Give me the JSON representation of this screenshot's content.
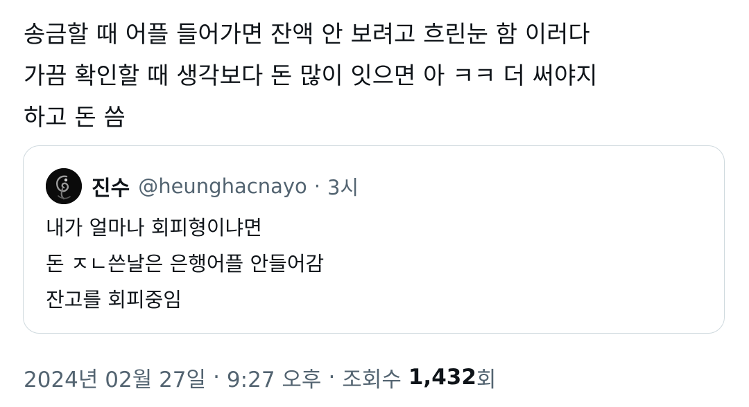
{
  "tweet": {
    "text_lines": [
      "송금할 때 어플 들어가면 잔액 안 보려고 흐린눈 함 이러다",
      "가끔 확인할 때 생각보다 돈 많이 잇으면 아 ㅋㅋ 더 써야지",
      "하고 돈 씀"
    ]
  },
  "quoted": {
    "avatar_icon": "spiral-face-avatar-icon",
    "display_name": "진수",
    "handle": "@heunghacnayo",
    "separator": "·",
    "time_ago": "3시",
    "text_lines": [
      "내가 얼마나 회피형이냐면",
      "돈 ㅈㄴ쓴날은 은행어플 안들어감",
      "잔고를 회피중임"
    ]
  },
  "meta": {
    "date": "2024년 02월 27일",
    "separator": "·",
    "time": "9:27 오후",
    "views_label": "조회수",
    "views_count": "1,432",
    "views_suffix": "회"
  },
  "colors": {
    "text_primary": "#0f1419",
    "text_secondary": "#536471",
    "border": "#cfd9de",
    "background": "#ffffff"
  }
}
